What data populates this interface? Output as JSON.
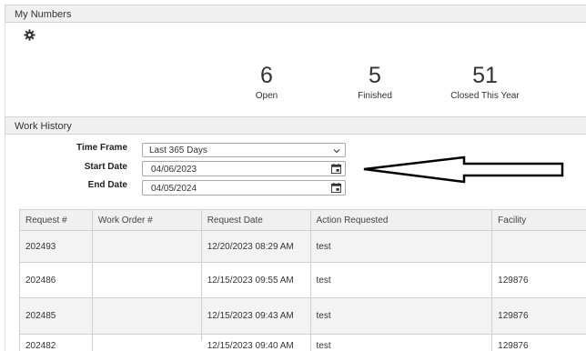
{
  "my_numbers": {
    "title": "My Numbers",
    "stats": [
      {
        "value": "6",
        "label": "Open"
      },
      {
        "value": "5",
        "label": "Finished"
      },
      {
        "value": "51",
        "label": "Closed This Year"
      }
    ]
  },
  "work_history": {
    "title": "Work History",
    "time_frame_label": "Time Frame",
    "time_frame_value": "Last 365 Days",
    "start_date_label": "Start Date",
    "start_date_value": "04/06/2023",
    "end_date_label": "End Date",
    "end_date_value": "04/05/2024"
  },
  "table": {
    "columns": [
      "Request #",
      "Work Order #",
      "Request Date",
      "Action Requested",
      "Facility"
    ],
    "rows": [
      [
        "202493",
        "",
        "12/20/2023 08:29 AM",
        "test",
        ""
      ],
      [
        "202486",
        "",
        "12/15/2023 09:55 AM",
        "test",
        "129876"
      ],
      [
        "202485",
        "",
        "12/15/2023 09:43 AM",
        "test",
        "129876"
      ],
      [
        "202482",
        "",
        "12/15/2023 09:40 AM",
        "test",
        "129876"
      ]
    ]
  },
  "icons": {
    "settings": "gear-icon",
    "calendar": "calendar-icon",
    "dropdown": "chevron-down-icon"
  }
}
